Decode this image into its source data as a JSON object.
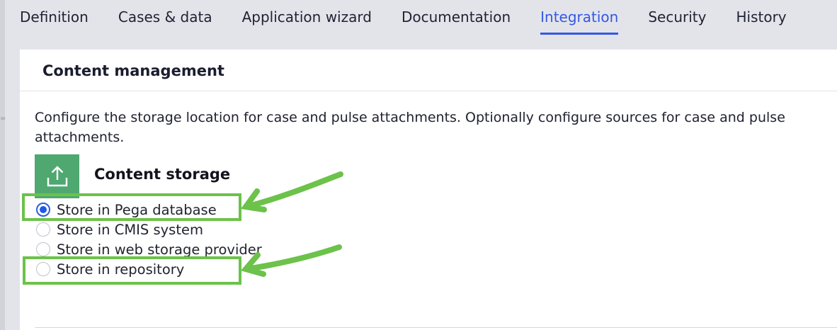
{
  "tabs": [
    {
      "label": "Definition",
      "active": false
    },
    {
      "label": "Cases & data",
      "active": false
    },
    {
      "label": "Application wizard",
      "active": false
    },
    {
      "label": "Documentation",
      "active": false
    },
    {
      "label": "Integration",
      "active": true
    },
    {
      "label": "Security",
      "active": false
    },
    {
      "label": "History",
      "active": false
    }
  ],
  "panel": {
    "title": "Content management",
    "description": "Configure the storage location for case and pulse attachments. Optionally configure sources for case and pulse attachments.",
    "section": {
      "icon": "upload-icon",
      "title": "Content storage",
      "options": [
        {
          "label": "Store in Pega database",
          "selected": true
        },
        {
          "label": "Store in CMIS system",
          "selected": false
        },
        {
          "label": "Store in web storage provider",
          "selected": false
        },
        {
          "label": "Store in repository",
          "selected": false
        }
      ]
    }
  },
  "colors": {
    "accent": "#3358e5",
    "annotation": "#6cc24a",
    "icon_bg": "#4ea870"
  }
}
